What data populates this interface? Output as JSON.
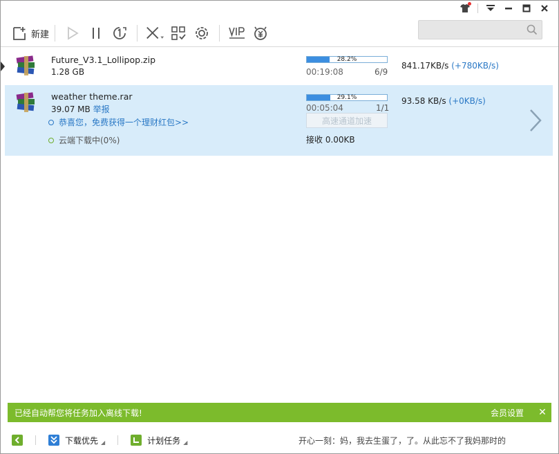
{
  "toolbar": {
    "new_label": "新建",
    "search": {
      "placeholder": ""
    }
  },
  "downloads": [
    {
      "name": "Future_V3.1_Lollipop.zip",
      "size": "1.28 GB",
      "progress_label": "28.2%",
      "progress_value": 0.282,
      "elapsed": "00:19:08",
      "pieces": "6/9",
      "speed": "841.17KB/s",
      "speed_delta": "(+780KB/s)"
    },
    {
      "name": "weather theme.rar",
      "size": "39.07 MB",
      "report": "举报",
      "progress_label": "29.1%",
      "progress_value": 0.291,
      "elapsed": "00:05:04",
      "pieces": "1/1",
      "speed": "93.58 KB/s",
      "speed_delta": "(+0KB/s)",
      "promo": "恭喜您，免费获得一个理财红包>>",
      "cloud_status": "云端下载中(0%)",
      "accel_button": "高速通道加速",
      "received": "接收 0.00KB"
    }
  ],
  "notice": {
    "message": "已经自动帮您将任务加入离线下载!",
    "member_settings": "会员设置",
    "close": "✕"
  },
  "statusbar": {
    "priority_label": "下载优先",
    "schedule_label": "计划任务",
    "message": "开心一刻：妈，我去生蛋了，了。从此忘不了我妈那时的"
  },
  "colors": {
    "progress_fill": "#3c8ee0",
    "selected_row": "#d8ecfa",
    "notice_green": "#7cbb2c",
    "link_blue": "#2a78c5"
  }
}
